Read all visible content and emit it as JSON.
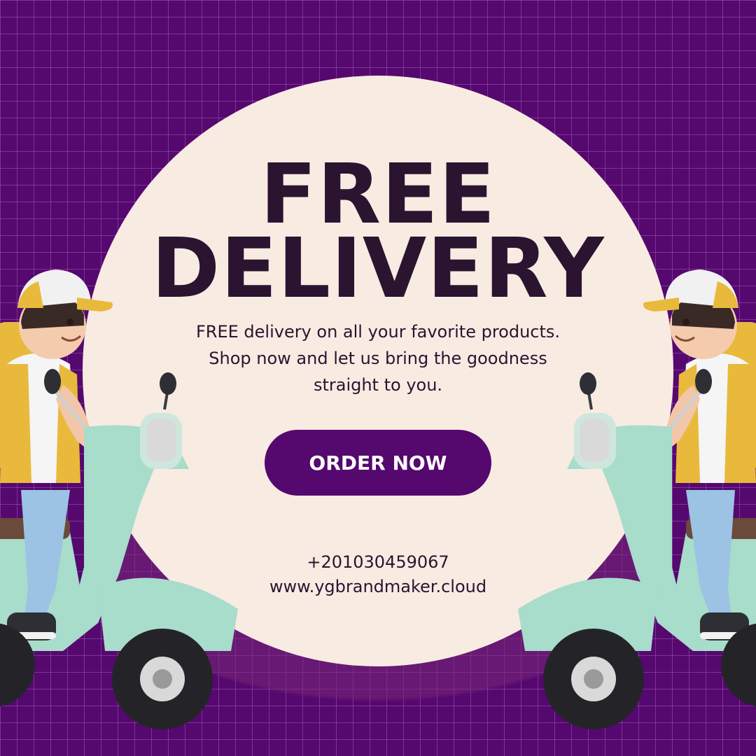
{
  "headline": {
    "line1": "FREE",
    "line2": "DELIVERY"
  },
  "description": {
    "line1": "FREE delivery on all your favorite products.",
    "line2": "Shop now and let us bring the goodness",
    "line3": "straight to you."
  },
  "cta": {
    "label": "ORDER NOW"
  },
  "contact": {
    "phone": "+201030459067",
    "website": "www.ygbrandmaker.cloud"
  },
  "colors": {
    "background": "#55086e",
    "grid": "#b27ad0",
    "circle": "#f8ebe2",
    "text": "#2a1430",
    "button": "#55086e",
    "scooter": "#a8dccb",
    "vest": "#e9b93c"
  },
  "illustrations": [
    "delivery-rider-left",
    "delivery-rider-right"
  ]
}
